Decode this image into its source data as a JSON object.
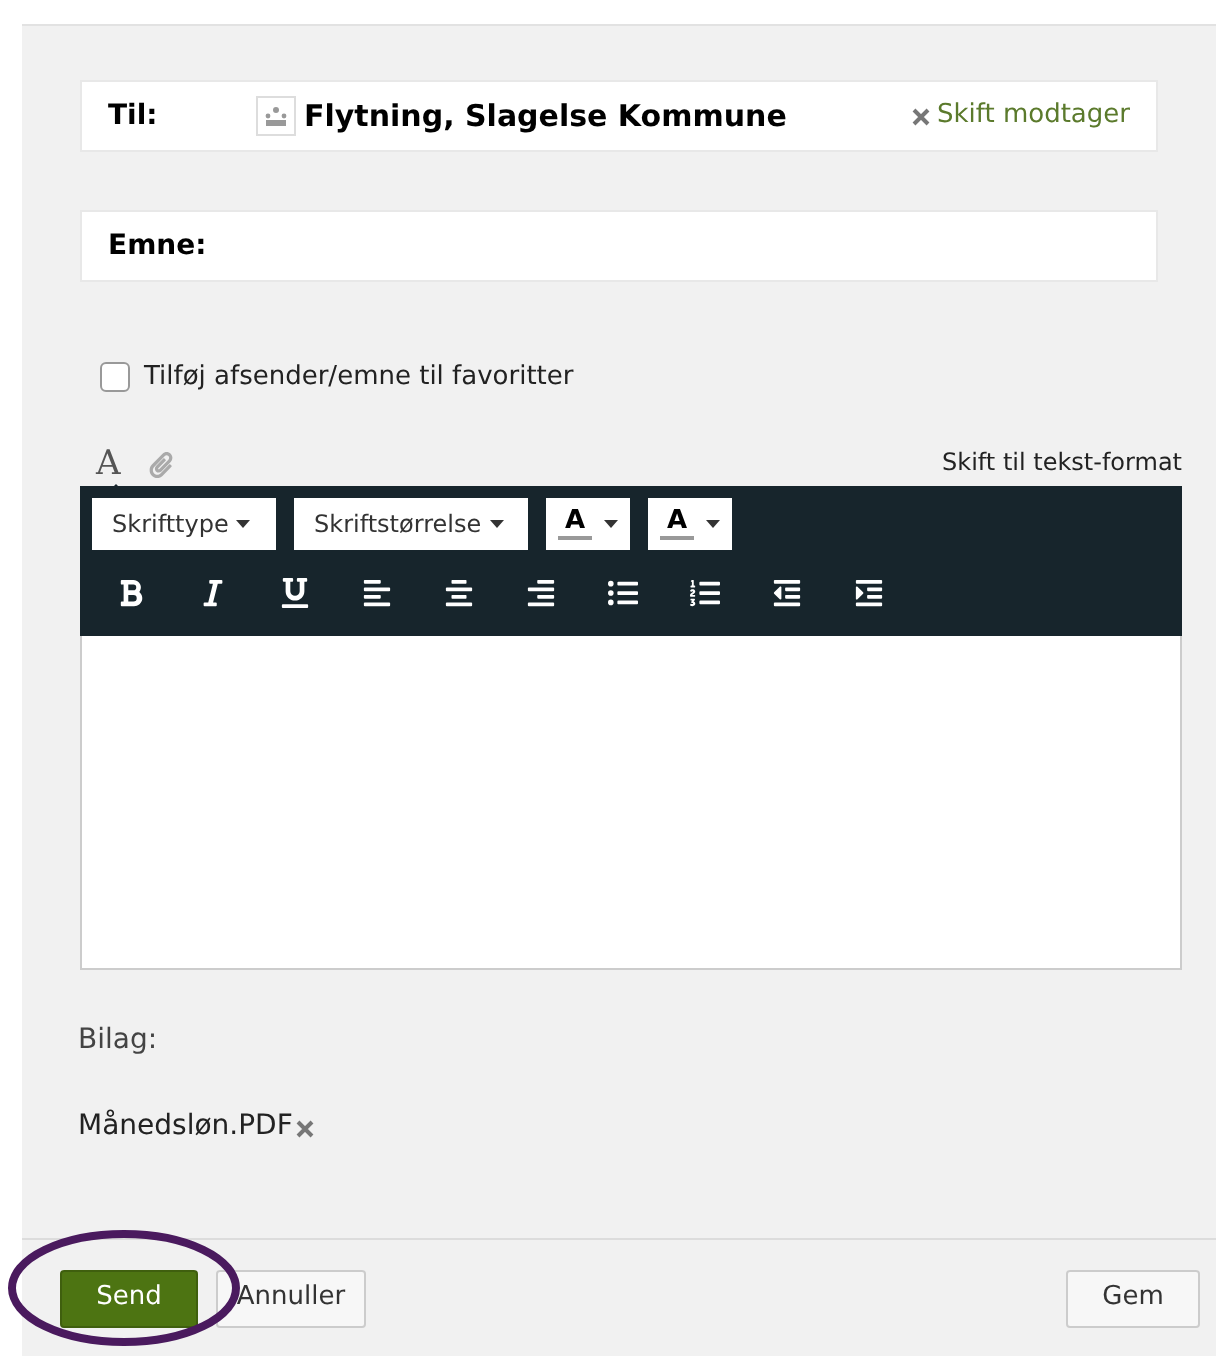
{
  "to": {
    "label": "Til:",
    "recipient": "Flytning, Slagelse Kommune",
    "change_link": "Skift modtager"
  },
  "subject": {
    "label": "Emne:"
  },
  "favorite": {
    "label": "Tilføj afsender/emne til favoritter",
    "checked": false
  },
  "editor_tabs": [
    {
      "kind": "text",
      "label": "A",
      "selected": true
    },
    {
      "kind": "attachment",
      "selected": false
    }
  ],
  "switch_format": "Skift til tekst-format",
  "dropdowns": [
    {
      "kind": "text",
      "label": "Skrifttype"
    },
    {
      "kind": "text",
      "label": "Skriftstørrelse"
    },
    {
      "kind": "color",
      "label": "A"
    },
    {
      "kind": "color",
      "label": "A"
    }
  ],
  "format_buttons": [
    {
      "kind": "bold"
    },
    {
      "kind": "italic"
    },
    {
      "kind": "underline"
    },
    {
      "kind": "align-left"
    },
    {
      "kind": "align-center"
    },
    {
      "kind": "align-right"
    },
    {
      "kind": "bullet-list"
    },
    {
      "kind": "numbered-list"
    },
    {
      "kind": "outdent"
    },
    {
      "kind": "indent"
    }
  ],
  "attachments": {
    "label": "Bilag:",
    "files": [
      "Månedsløn.PDF"
    ]
  },
  "buttons": {
    "send": "Send",
    "cancel": "Annuller",
    "save": "Gem"
  },
  "send_circled": true
}
